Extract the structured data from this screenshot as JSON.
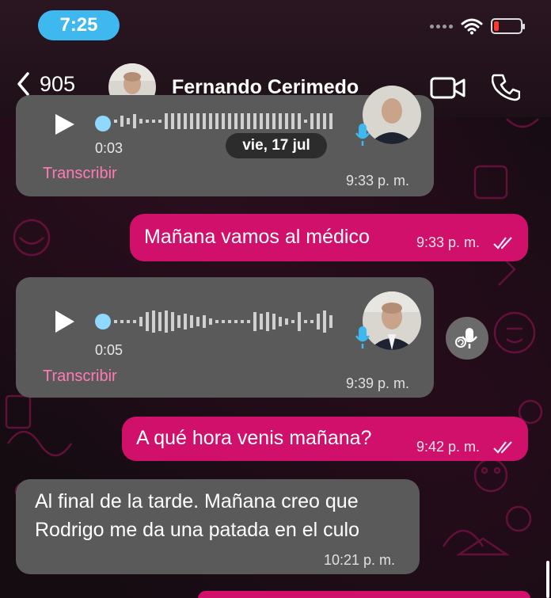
{
  "status_bar": {
    "time": "7:25",
    "battery_level": 0.2
  },
  "header": {
    "back_count": "905",
    "contact_name": "Fernando Cerimedo"
  },
  "date_separator": "vie, 17 jul",
  "messages": [
    {
      "type": "voice",
      "direction": "in",
      "duration": "0:03",
      "transcribe_label": "Transcribir",
      "time": "9:33 p. m."
    },
    {
      "type": "text",
      "direction": "out",
      "text": "Mañana vamos al médico",
      "time": "9:33 p. m.",
      "status": "read"
    },
    {
      "type": "voice",
      "direction": "in",
      "duration": "0:05",
      "transcribe_label": "Transcribir",
      "time": "9:39 p. m."
    },
    {
      "type": "text",
      "direction": "out",
      "text": "A qué hora venis mañana?",
      "time": "9:42 p. m.",
      "status": "read"
    },
    {
      "type": "text",
      "direction": "in",
      "lines": [
        "Al final de la tarde. Mañana creo que",
        "Rodrigo me da una patada en el culo"
      ],
      "time": "10:21 p. m."
    }
  ],
  "colors": {
    "outgoing": "#d0106a",
    "incoming": "#5a5a5a",
    "time_pill": "#3fb8f0",
    "link": "#ff7bb8",
    "read_ticks": "#e9e9ff"
  }
}
